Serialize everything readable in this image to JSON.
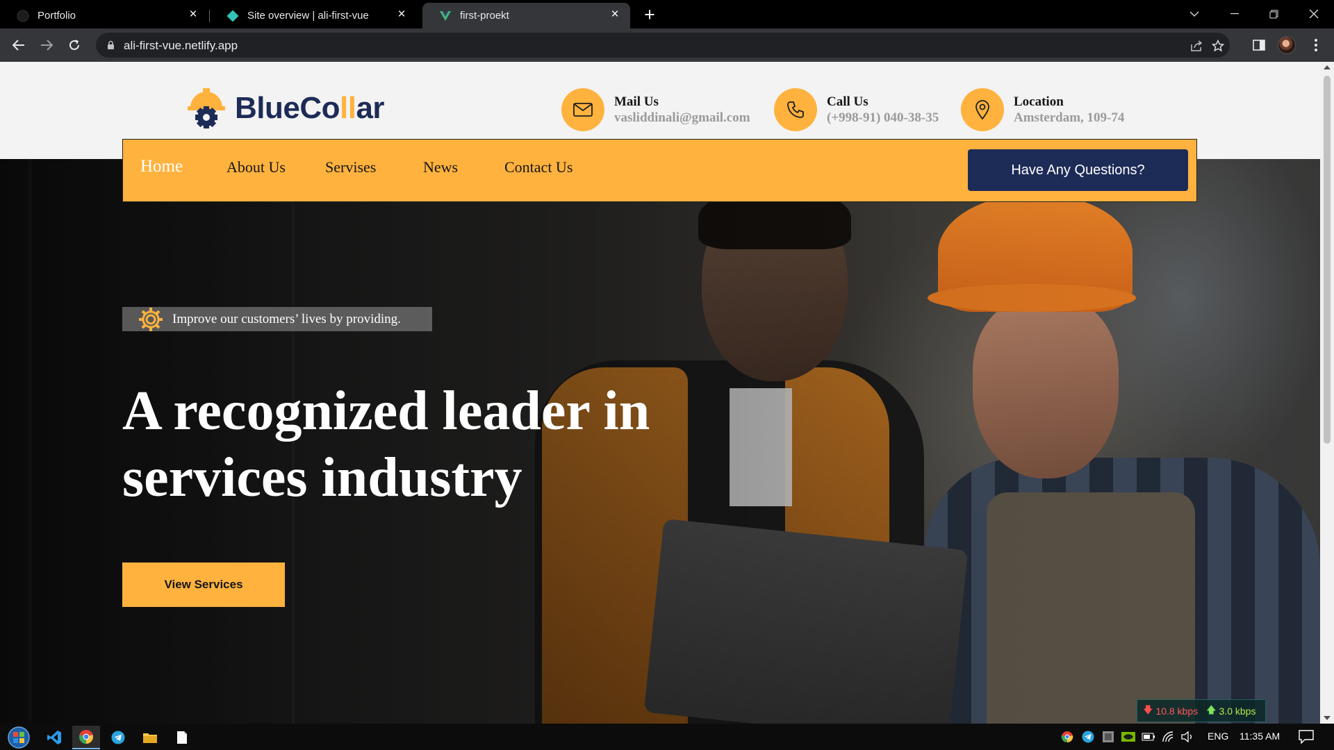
{
  "browser": {
    "tabs": [
      {
        "title": "Portfolio",
        "icon": "dark-circle-icon",
        "active": false
      },
      {
        "title": "Site overview | ali-first-vue",
        "icon": "netlify-icon",
        "active": false
      },
      {
        "title": "first-proekt",
        "icon": "vue-icon",
        "active": true
      }
    ],
    "url": "ali-first-vue.netlify.app"
  },
  "site": {
    "logo": {
      "part1": "BlueCo",
      "part2": "ll",
      "part3": "ar"
    },
    "contacts": [
      {
        "label": "Mail Us",
        "value": "vasliddinali@gmail.com",
        "icon": "mail-icon"
      },
      {
        "label": "Call Us",
        "value": "(+998-91) 040-38-35",
        "icon": "phone-icon"
      },
      {
        "label": "Location",
        "value": "Amsterdam, 109-74",
        "icon": "location-pin-icon"
      }
    ],
    "nav": [
      {
        "label": "Home",
        "active": true
      },
      {
        "label": "About Us"
      },
      {
        "label": "Servises"
      },
      {
        "label": "News"
      },
      {
        "label": "Contact Us"
      }
    ],
    "cta": "Have Any Questions?",
    "hero": {
      "tagline": "Improve our customers’ lives by providing.",
      "headline_line1": "A recognized leader in",
      "headline_line2": "services industry",
      "button": "View Services"
    },
    "colors": {
      "accent": "#ffb23e",
      "brand": "#1d2b57"
    }
  },
  "netspeed": {
    "down": "10.8 kbps",
    "up": "3.0 kbps"
  },
  "taskbar": {
    "lang": "ENG",
    "time": "11:35 AM"
  }
}
